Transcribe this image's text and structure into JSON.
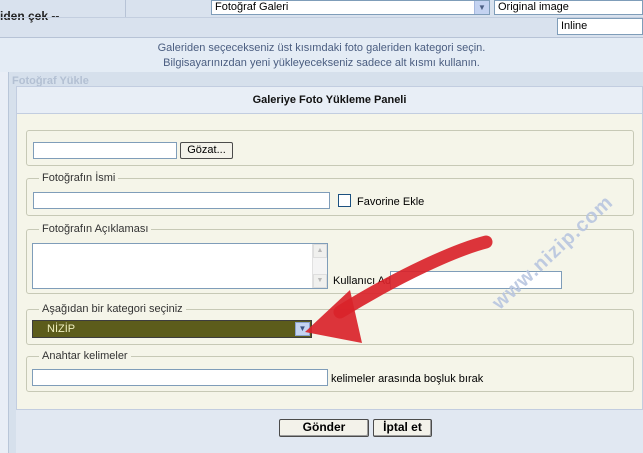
{
  "top": {
    "left_label": "iden çek --",
    "gallery_select": "Fotoğraf Galeri",
    "image_size_select": "Original image",
    "display_select": "Inline"
  },
  "info": {
    "line1": "Galeriden seçecekseniz üst kısımdaki foto galeriden kategori seçin.",
    "line2": "Bilgisayarınızdan yeni yükleyecekseniz sadece alt kısmı kullanın."
  },
  "panel": {
    "faded_title": "Fotoğraf Yükle",
    "header": "Galeriye Foto Yükleme Paneli"
  },
  "form": {
    "browse_button": "Gözat...",
    "photo_name_legend": "Fotoğrafın İsmi",
    "favorite_label": "Favorine Ekle",
    "description_legend": "Fotoğrafın Açıklaması",
    "username_label": "Kullanıcı Adı",
    "category_legend": "Aşağıdan bir kategori seçiniz",
    "category_selected": "NİZİP",
    "keywords_legend": "Anahtar kelimeler",
    "keywords_hint": "kelimeler arasında boşluk bırak"
  },
  "actions": {
    "submit": "Gönder",
    "cancel": "İptal et"
  },
  "watermark": "www.nizip.com",
  "colors": {
    "arrow": "#d9232a",
    "category_bg": "#5c5c1b"
  }
}
